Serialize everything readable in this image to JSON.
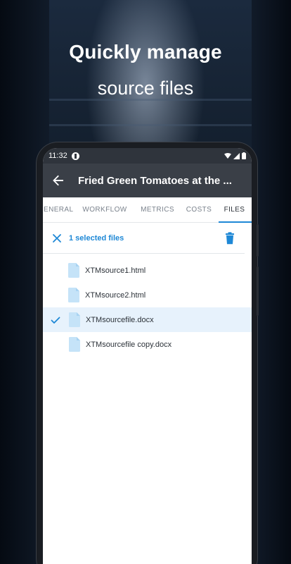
{
  "headline": "Quickly manage",
  "subheadline": "source files",
  "status_bar": {
    "time": "11:32"
  },
  "app_bar": {
    "title": "Fried Green Tomatoes at the ..."
  },
  "tabs": [
    {
      "label": "ENERAL",
      "active": false
    },
    {
      "label": "WORKFLOW",
      "active": false
    },
    {
      "label": "METRICS",
      "active": false
    },
    {
      "label": "COSTS",
      "active": false
    },
    {
      "label": "FILES",
      "active": true
    }
  ],
  "selection": {
    "count_label": "1 selected files"
  },
  "files": [
    {
      "name": "XTMsource1.html",
      "selected": false
    },
    {
      "name": "XTMsource2.html",
      "selected": false
    },
    {
      "name": "XTMsourcefile.docx",
      "selected": true
    },
    {
      "name": "XTMsourcefile copy.docx",
      "selected": false
    }
  ],
  "colors": {
    "accent": "#1e88d6",
    "app_bar": "#3a3f47",
    "status_bar": "#2f343c",
    "selected_row": "#e7f2fc",
    "file_icon": "#c5e3f8"
  },
  "icons": {
    "back": "arrow-left-icon",
    "close": "close-icon",
    "delete": "trash-icon",
    "check": "check-icon",
    "file": "file-icon"
  }
}
